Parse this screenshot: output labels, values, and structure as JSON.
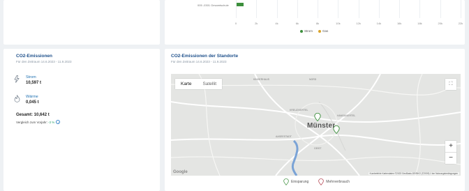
{
  "top_chart": {
    "category_label": "005 -0301 Gesamtschule",
    "ticks": [
      "0",
      "2k",
      "4k",
      "6k",
      "8k",
      "10k",
      "12k",
      "14k",
      "16k",
      "18k",
      "20k",
      "22k"
    ],
    "legend": [
      {
        "label": "Strom",
        "color": "#3c8f3c"
      },
      {
        "label": "Gas",
        "color": "#d9a42b"
      }
    ],
    "chart_data": {
      "type": "bar",
      "orientation": "horizontal",
      "categories": [
        "005 -0301 Gesamtschule"
      ],
      "series": [
        {
          "name": "Strom",
          "values": [
            750
          ]
        },
        {
          "name": "Gas",
          "values": [
            0
          ]
        }
      ],
      "xlim": [
        0,
        22000
      ]
    }
  },
  "co2_emissions": {
    "title": "CO2-Emissionen",
    "subtitle": "Für den Zeitraum 14.6.2023 - 11.9.2023",
    "items": [
      {
        "label": "Strom",
        "value": "10,597 t",
        "icon": "lightning-icon"
      },
      {
        "label": "Wärme",
        "value": "0,045 t",
        "icon": "flame-icon"
      }
    ],
    "total": "Gesamt: 10,642 t",
    "comparison_text": "Vergleich zum Vorjahr:",
    "comparison_value": "-3 %"
  },
  "map_card": {
    "title": "CO2-Emissionen der Standorte",
    "subtitle": "Für den Zeitraum 14.6.2023 - 11.9.2023",
    "toggle": {
      "map": "Karte",
      "satellite": "Satellit"
    },
    "city": "Münster",
    "districts": [
      "KREUZVIERTEL",
      "NORD",
      "HANSAVIERTEL",
      "KINDERHAUS",
      "AASEESTADT",
      "GEIST"
    ],
    "footer": "Kurzbefehle   Kartendaten ©2023 GeoBasis-DE/BKG (©2009)   1 km   Nutzungsbedingungen",
    "google": "Google",
    "zoom_in": "+",
    "zoom_out": "−",
    "legend": [
      {
        "label": "Einsparung",
        "color": "#3c8f3c"
      },
      {
        "label": "Mehrverbrauch",
        "color": "#b03a48"
      }
    ]
  }
}
